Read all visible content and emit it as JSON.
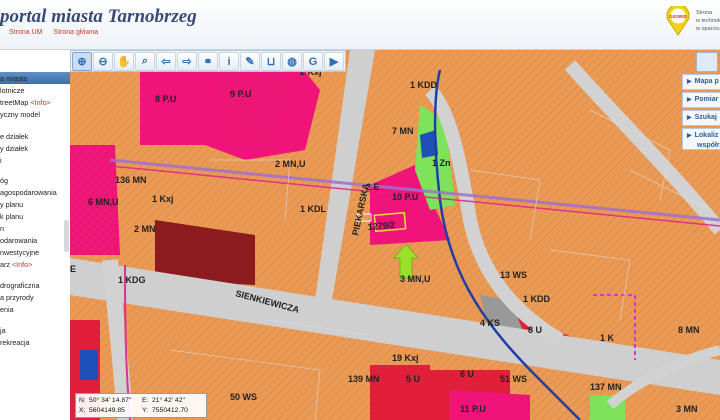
{
  "header": {
    "title": "portal miasta Tarnobrzeg",
    "links": [
      "Strona UM",
      "Strona główna"
    ],
    "geobid_label": "GEOBID",
    "right_text": [
      "Strona",
      "w technologii",
      "w oparciu"
    ]
  },
  "sidebar": {
    "items": [
      {
        "label": "a miasta",
        "info": ""
      },
      {
        "label": "lotnicze",
        "info": ""
      },
      {
        "label": "treetMap ",
        "info": "<Info>"
      },
      {
        "label": "yczny model",
        "info": ""
      },
      {
        "label": "e działek",
        "info": ""
      },
      {
        "label": "y działek",
        "info": ""
      },
      {
        "label": "i",
        "info": ""
      },
      {
        "label": "óg",
        "info": ""
      },
      {
        "label": "agospodarowania",
        "info": ""
      },
      {
        "label": "y planu",
        "info": ""
      },
      {
        "label": "k planu",
        "info": ""
      },
      {
        "label": "n",
        "info": ""
      },
      {
        "label": "odarowania",
        "info": ""
      },
      {
        "label": "nwestycyjne",
        "info": ""
      },
      {
        "label": "arz ",
        "info": "<Info>"
      },
      {
        "label": "drograficzna",
        "info": ""
      },
      {
        "label": "a przyrody",
        "info": ""
      },
      {
        "label": "enia",
        "info": ""
      },
      {
        "label": "ja",
        "info": ""
      },
      {
        "label": "rekreacja",
        "info": ""
      }
    ]
  },
  "toolbar": {
    "tools": [
      {
        "icon": "zoom-in-icon",
        "glyph": "⊕",
        "active": true
      },
      {
        "icon": "zoom-out-icon",
        "glyph": "⊖"
      },
      {
        "icon": "pan-hand-icon",
        "glyph": "✋"
      },
      {
        "icon": "zoom-window-icon",
        "glyph": "⌕"
      },
      {
        "icon": "arrow-back-icon",
        "glyph": "⇦"
      },
      {
        "icon": "arrow-forward-icon",
        "glyph": "⇨"
      },
      {
        "icon": "link-icon",
        "glyph": "⚭"
      },
      {
        "icon": "info-icon",
        "glyph": "i"
      },
      {
        "icon": "pencil-icon",
        "glyph": "✎"
      },
      {
        "icon": "measure-icon",
        "glyph": "⊔"
      },
      {
        "icon": "globe-icon",
        "glyph": "◍"
      },
      {
        "icon": "google-icon",
        "glyph": "G"
      },
      {
        "icon": "video-camera-icon",
        "glyph": "▶"
      }
    ]
  },
  "right_panel": {
    "items": [
      "Mapa p",
      "Pomiar",
      "Szukaj",
      "Lokaliz",
      "współr"
    ]
  },
  "coordinates": {
    "n_label": "N:",
    "n_value": "50° 34' 14.87\"",
    "e_label": "E:",
    "e_value": "21° 42' 42\"",
    "x_label": "X:",
    "x_value": "5604149.85",
    "y_label": "Y:",
    "y_value": "7550412.70"
  },
  "map_labels": [
    "8 P.U",
    "9 P.U",
    "2 Kxj",
    "1 KDD",
    "7 MN",
    "1 Zn",
    "136 MN",
    "2 MN,U",
    "6 MN,U",
    "1 Kxj",
    "1 KDL",
    "2 E",
    "10 P.U",
    "1279/2",
    "2 MN",
    "PIEKARSKA",
    "E",
    "1 KDG",
    "SIENKIEWICZA",
    "3 MN,U",
    "13 WS",
    "1 KDD",
    "4 KS",
    "8 U",
    "8 MN",
    "1 K",
    "19 Kxj",
    "139 MN",
    "5 U",
    "6 U",
    "51 WS",
    "137 MN",
    "50 WS",
    "11 P.U",
    "3 MN"
  ],
  "colors": {
    "residential": "#ea9a54",
    "services_pink": "#f0147a",
    "services_dark": "#8b1b1e",
    "services_red": "#e0203a",
    "green": "#7ee25a",
    "water": "#1f4fb8",
    "road": "#cfcfcf",
    "accent": "#3a4a77"
  }
}
